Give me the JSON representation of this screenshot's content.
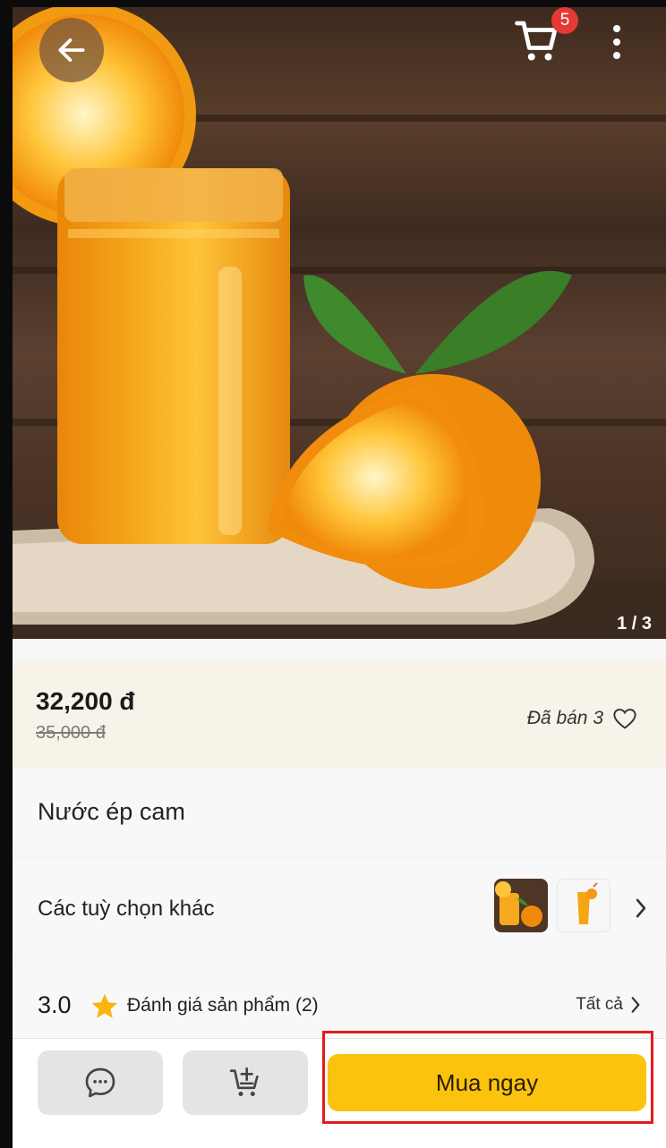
{
  "header": {
    "back_icon": "arrow-left-icon",
    "cart_icon": "shopping-cart-icon",
    "cart_count": "5",
    "more_icon": "more-vertical-icon"
  },
  "gallery": {
    "counter": "1 / 3"
  },
  "price": {
    "current": "32,200 đ",
    "original": "35,000 đ",
    "sold": "Đã bán 3",
    "favorite_icon": "heart-outline-icon"
  },
  "product": {
    "title": "Nước ép cam"
  },
  "options": {
    "label": "Các tuỳ chọn khác",
    "arrow_icon": "chevron-right-icon"
  },
  "rating": {
    "score": "3.0",
    "star_icon": "star-icon",
    "label": "Đánh giá sản phẩm (2)",
    "all_link": "Tất cả"
  },
  "actions": {
    "chat_icon": "chat-bubble-icon",
    "add_cart_icon": "cart-plus-icon",
    "buy_label": "Mua ngay"
  },
  "colors": {
    "accent": "#fbc30e",
    "badge": "#e53935",
    "star": "#fbb40f",
    "highlight": "#e41b1b",
    "price_bg": "#f8f3e8"
  }
}
